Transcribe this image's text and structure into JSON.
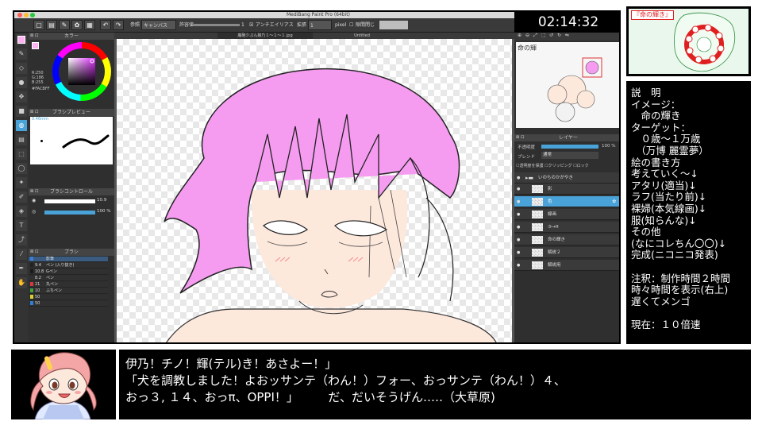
{
  "window": {
    "title": "MediBang Paint Pro (64bit)"
  },
  "toolbar": {
    "ref_label": "参照",
    "ref_value": "キャンバス",
    "tolerance_label": "許容値",
    "tolerance_value": "1",
    "antialias_label": "アンチエイリアス",
    "expand_label": "拡張",
    "expand_value": "1",
    "expand_unit": "pixel",
    "gap_label": "隙間閉じ",
    "timer": "02:14:32"
  },
  "tabs": [
    "魔砲少ぷん娘乃１～１～１.jpg",
    "Untitled"
  ],
  "left_panel": {
    "color_header": "カラー",
    "color_values": [
      "R:250",
      "G:186",
      "B:255"
    ],
    "hex": "#FACBFF",
    "brush_preview_header": "ブラシプレビュー",
    "brush_size": "0.46mm",
    "brush_control_header": "ブラシコントロール",
    "size_value": "10.9",
    "opacity_value": "100 %",
    "brush_header": "ブラシ",
    "brushes": [
      {
        "size": "",
        "name": "影筆",
        "color": "#3a7fd6"
      },
      {
        "size": "9.4",
        "name": "ペン (入り抜き)",
        "color": "#222222"
      },
      {
        "size": "10.8",
        "name": "Gペン",
        "color": "#1a1a1a"
      },
      {
        "size": "8.2",
        "name": "ペン",
        "color": "#303030"
      },
      {
        "size": "21",
        "name": "丸ペン",
        "color": "#d43a3a"
      },
      {
        "size": "10",
        "name": "ふちペン",
        "color": "#40a040"
      },
      {
        "size": "50",
        "name": "",
        "color": "#d8d030"
      },
      {
        "size": "50",
        "name": "",
        "color": "#2f7fd8"
      }
    ]
  },
  "right_panel": {
    "layer_header": "レイヤー",
    "opacity_label": "不透明度",
    "opacity_value": "100 %",
    "blend_label": "ブレンド",
    "blend_value": "通常",
    "protect_label": "透明度を保護",
    "clipping_label": "クリッピング",
    "lock_label": "ロック",
    "folder_name": "いのちのかがやき",
    "layers": [
      {
        "name": "影",
        "selected": false
      },
      {
        "name": "色",
        "selected": true
      },
      {
        "name": "線画",
        "selected": false
      },
      {
        "name": "③→H",
        "selected": false
      },
      {
        "name": "命の輝き",
        "selected": false
      },
      {
        "name": "解説２",
        "selected": false
      },
      {
        "name": "解説用",
        "selected": false
      }
    ]
  },
  "thumbnail": {
    "title": "『命の輝き』",
    "accent": "#e02020"
  },
  "notes": [
    "説　明",
    "イメージ：",
    "　命の輝き",
    "ターゲット：",
    "　０歳～１万歳",
    "　（万博 麗霊夢）",
    "絵の書き方",
    "考えていく～↓",
    "アタリ(適当)↓",
    "ラフ(当たり前)↓",
    "裸婦(本気線画)↓",
    "服(知らんな)↓",
    "その他",
    "(なにコレちん〇〇)↓",
    "完成(ニコニコ発表)",
    "",
    "注釈：制作時間２時間",
    "時々時間を表示(右上)",
    "遅くてメンゴ",
    "",
    "現在：１０倍速"
  ],
  "subtitle": [
    "伊乃！チノ！輝(テル)き！あさよー！」",
    "「犬を調教しました！よおッサンテ（わん！）フォー、おっサンテ（わん！）４、",
    "おっ３, １４、おっπ、OPPI！」　　　だ、だいそうげん…‥（大草原)"
  ],
  "colors": {
    "hair": "#f59cf0",
    "skin": "#fde8dc",
    "accent": "#4aa3d8",
    "highlight_fill": "#ff9de9"
  }
}
